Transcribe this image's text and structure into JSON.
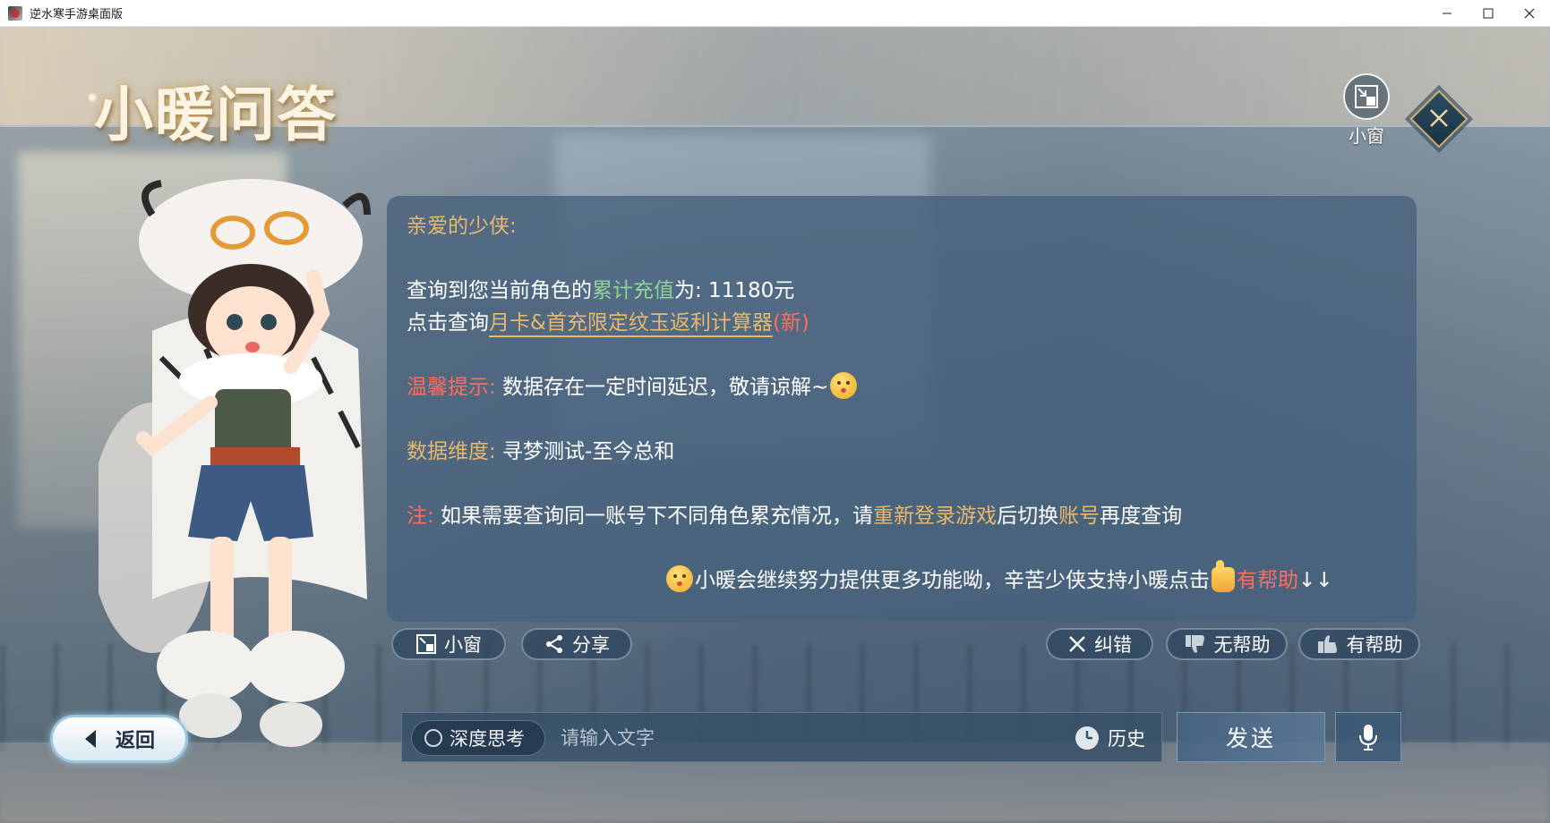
{
  "window": {
    "title": "逆水寒手游桌面版",
    "minimize": "—",
    "maximize": "☐",
    "close": "✕"
  },
  "header": {
    "title": "小暖问答",
    "mini_window_label": "小窗"
  },
  "answer": {
    "greeting": "亲爱的少侠:",
    "line1_prefix": "查询到您当前角色的",
    "line1_highlight": "累计充值",
    "line1_suffix": "为: 11180元",
    "line2_prefix": "点击查询",
    "line2_link": "月卡&首充限定纹玉返利计算器",
    "line2_new": "(新)",
    "tip_label": "温馨提示:",
    "tip_text": " 数据存在一定时间延迟，敬请谅解~",
    "dimension_label": "数据维度:",
    "dimension_text": " 寻梦测试-至今总和",
    "note_label": "注:",
    "note_text_1": " 如果需要查询同一账号下不同角色累充情况，请",
    "note_highlight_1": "重新登录游戏",
    "note_text_2": "后切换",
    "note_highlight_2": "账号",
    "note_text_3": "再度查询",
    "footer_text": "小暖会继续努力提供更多功能呦，辛苦少侠支持小暖点击",
    "footer_highlight": "有帮助",
    "footer_arrows": "↓↓"
  },
  "actions": {
    "mini_window": "小窗",
    "share": "分享",
    "correct": "纠错",
    "not_helpful": "无帮助",
    "helpful": "有帮助"
  },
  "bottom": {
    "back": "返回",
    "deep_think": "深度思考",
    "input_placeholder": "请输入文字",
    "history": "历史",
    "send": "发送"
  },
  "colors": {
    "gold": "#e9b86b",
    "green": "#8fd39a",
    "red": "#ff6d5c"
  }
}
